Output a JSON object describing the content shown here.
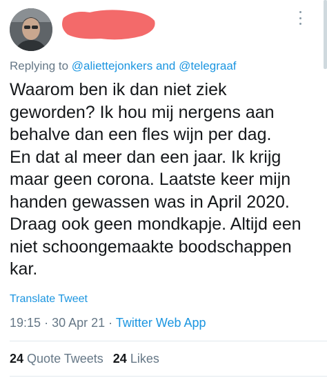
{
  "tweet": {
    "replying_prefix": "Replying to",
    "reply_to": [
      "@aliettejonkers",
      "@telegraaf"
    ],
    "reply_joiner": "and",
    "text": "Waarom ben ik dan niet ziek\ngeworden? Ik hou mij nergens aan\nbehalve dan een fles wijn per dag.\nEn dat al meer dan een jaar. Ik krijg\nmaar geen corona. Laatste keer mijn\nhanden gewassen was in April 2020.\nDraag ook geen mondkapje. Altijd een\nniet schoongemaakte boodschappen\nkar.",
    "translate_label": "Translate Tweet",
    "time": "19:15",
    "date": "30 Apr 21",
    "separator": "·",
    "source": "Twitter Web App"
  },
  "stats": {
    "quote_count": "24",
    "quote_label": "Quote Tweets",
    "likes_count": "24",
    "likes_label": "Likes"
  },
  "icons": {
    "menu": "more-vertical-icon"
  },
  "colors": {
    "link": "#1b95e0",
    "muted": "#657786",
    "redaction": "#f36a6a"
  }
}
